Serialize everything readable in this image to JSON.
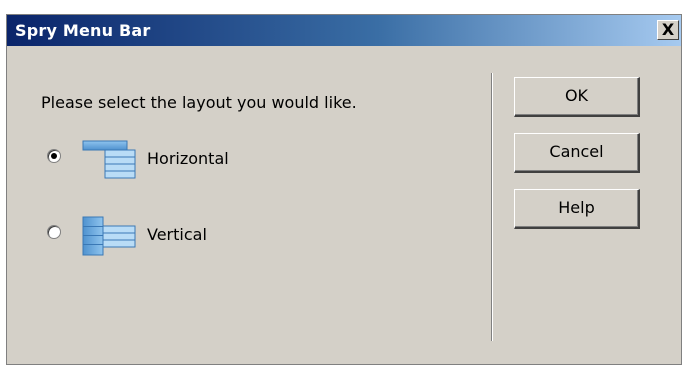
{
  "window": {
    "title": "Spry Menu Bar",
    "close_glyph": "X"
  },
  "prompt": "Please select the layout you would like.",
  "options": [
    {
      "label": "Horizontal",
      "selected": true,
      "icon": "horizontal-layout-icon"
    },
    {
      "label": "Vertical",
      "selected": false,
      "icon": "vertical-layout-icon"
    }
  ],
  "buttons": {
    "ok": "OK",
    "cancel": "Cancel",
    "help": "Help"
  },
  "colors": {
    "titlebar_start": "#0a246a",
    "titlebar_end": "#a6caf0",
    "dialog_bg": "#d4d0c8",
    "icon_blue": "#5ba3d9"
  }
}
